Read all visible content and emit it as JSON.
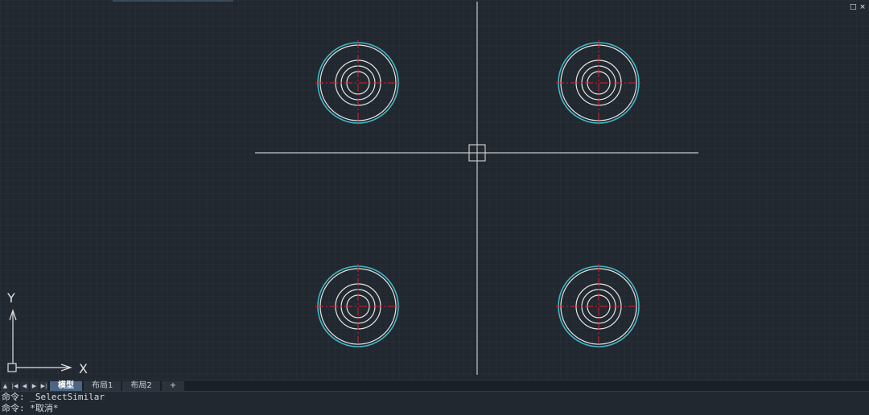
{
  "window": {
    "restore_icon": "□",
    "close_icon": "×"
  },
  "ucs": {
    "x_label": "X",
    "y_label": "Y"
  },
  "tabs": {
    "nav_first": "▲",
    "nav_prev_end": "|◀",
    "nav_prev": "◀",
    "nav_next": "▶",
    "nav_last": "▶|",
    "items": [
      {
        "label": "模型",
        "active": true
      },
      {
        "label": "布局1",
        "active": false
      },
      {
        "label": "布局2",
        "active": false
      },
      {
        "label": "+",
        "active": false
      }
    ]
  },
  "command_history": [
    "命令: _SelectSimilar",
    "命令: *取消*"
  ],
  "colors": {
    "background": "#212830",
    "outer_circle": "#3fb8c4",
    "circles": "#e6e6e6",
    "centerline": "#e0202a",
    "crosshair": "#c8c8c8"
  }
}
